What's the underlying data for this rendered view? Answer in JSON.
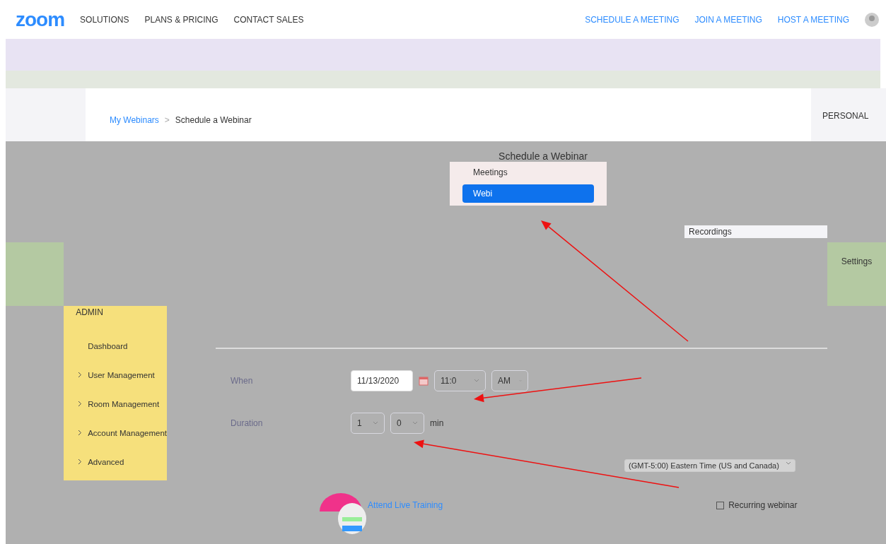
{
  "top_nav": {
    "logo": "zoom",
    "left_links": [
      "SOLUTIONS",
      "PLANS & PRICING",
      "CONTACT SALES"
    ],
    "right_links": [
      "SCHEDULE A MEETING",
      "JOIN A MEETING",
      "HOST A MEETING"
    ]
  },
  "breadcrumb": {
    "link": "My Webinars",
    "separator": ">",
    "current": "Schedule a Webinar"
  },
  "personal_heading": "PERSONAL",
  "page_heading": "Schedule a Webinar",
  "menu": [
    {
      "label": "Meetings",
      "selected": false
    },
    {
      "label": "Webi",
      "selected": true
    }
  ],
  "recordings": "Recordings",
  "settings": "Settings",
  "admin": {
    "heading": "ADMIN",
    "items": [
      {
        "label": "Dashboard",
        "kind": "link"
      },
      {
        "label": "User Management",
        "kind": "group"
      },
      {
        "label": "Room Management",
        "kind": "group"
      },
      {
        "label": "Account Management",
        "kind": "group"
      },
      {
        "label": "Advanced",
        "kind": "group"
      }
    ]
  },
  "form": {
    "when_label": "When",
    "date": "11/13/2020",
    "time": "11:0",
    "ampm": "AM",
    "duration_label": "Duration",
    "hours": "1",
    "minutes": "0",
    "min_unit": "min",
    "time_zone": "(GMT-5:00) Eastern Time (US and Canada)",
    "recurring": {
      "label": "Recurring webinar",
      "checked": false
    }
  },
  "training_link": "Attend Live Training"
}
